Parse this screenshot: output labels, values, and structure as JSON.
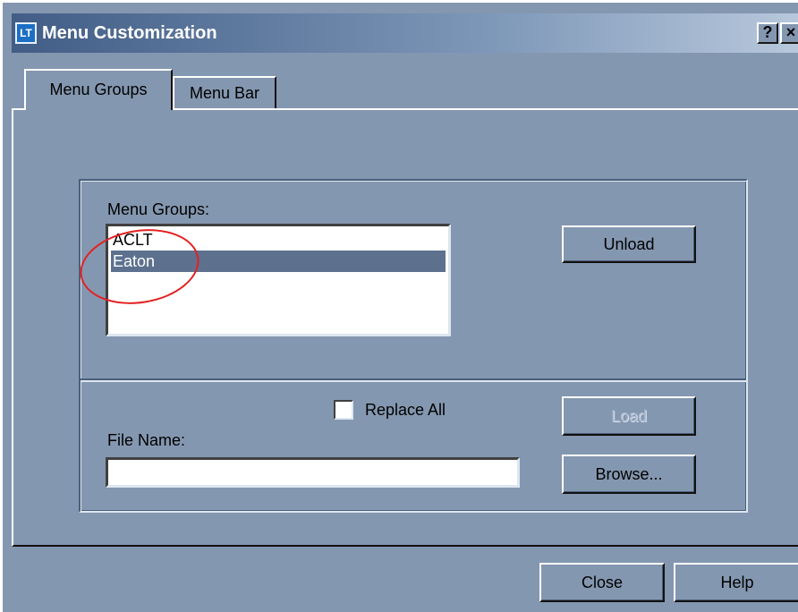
{
  "window": {
    "title": "Menu Customization",
    "app_icon_text": "LT",
    "help_button": "?",
    "close_button": "×"
  },
  "tabs": [
    {
      "label": "Menu Groups",
      "selected": true
    },
    {
      "label": "Menu Bar",
      "selected": false
    }
  ],
  "menu_groups": {
    "label": "Menu Groups:",
    "items": [
      "ACLT",
      "Eaton"
    ],
    "selected_index": 1
  },
  "buttons": {
    "unload": "Unload",
    "load": "Load",
    "browse": "Browse...",
    "close": "Close",
    "help": "Help"
  },
  "replace_all": {
    "label": "Replace All",
    "checked": false
  },
  "file_name": {
    "label": "File Name:",
    "value": ""
  },
  "colors": {
    "dialog_bg": "#8497b0",
    "selection": "#5d718f",
    "annotation": "#e42020"
  }
}
